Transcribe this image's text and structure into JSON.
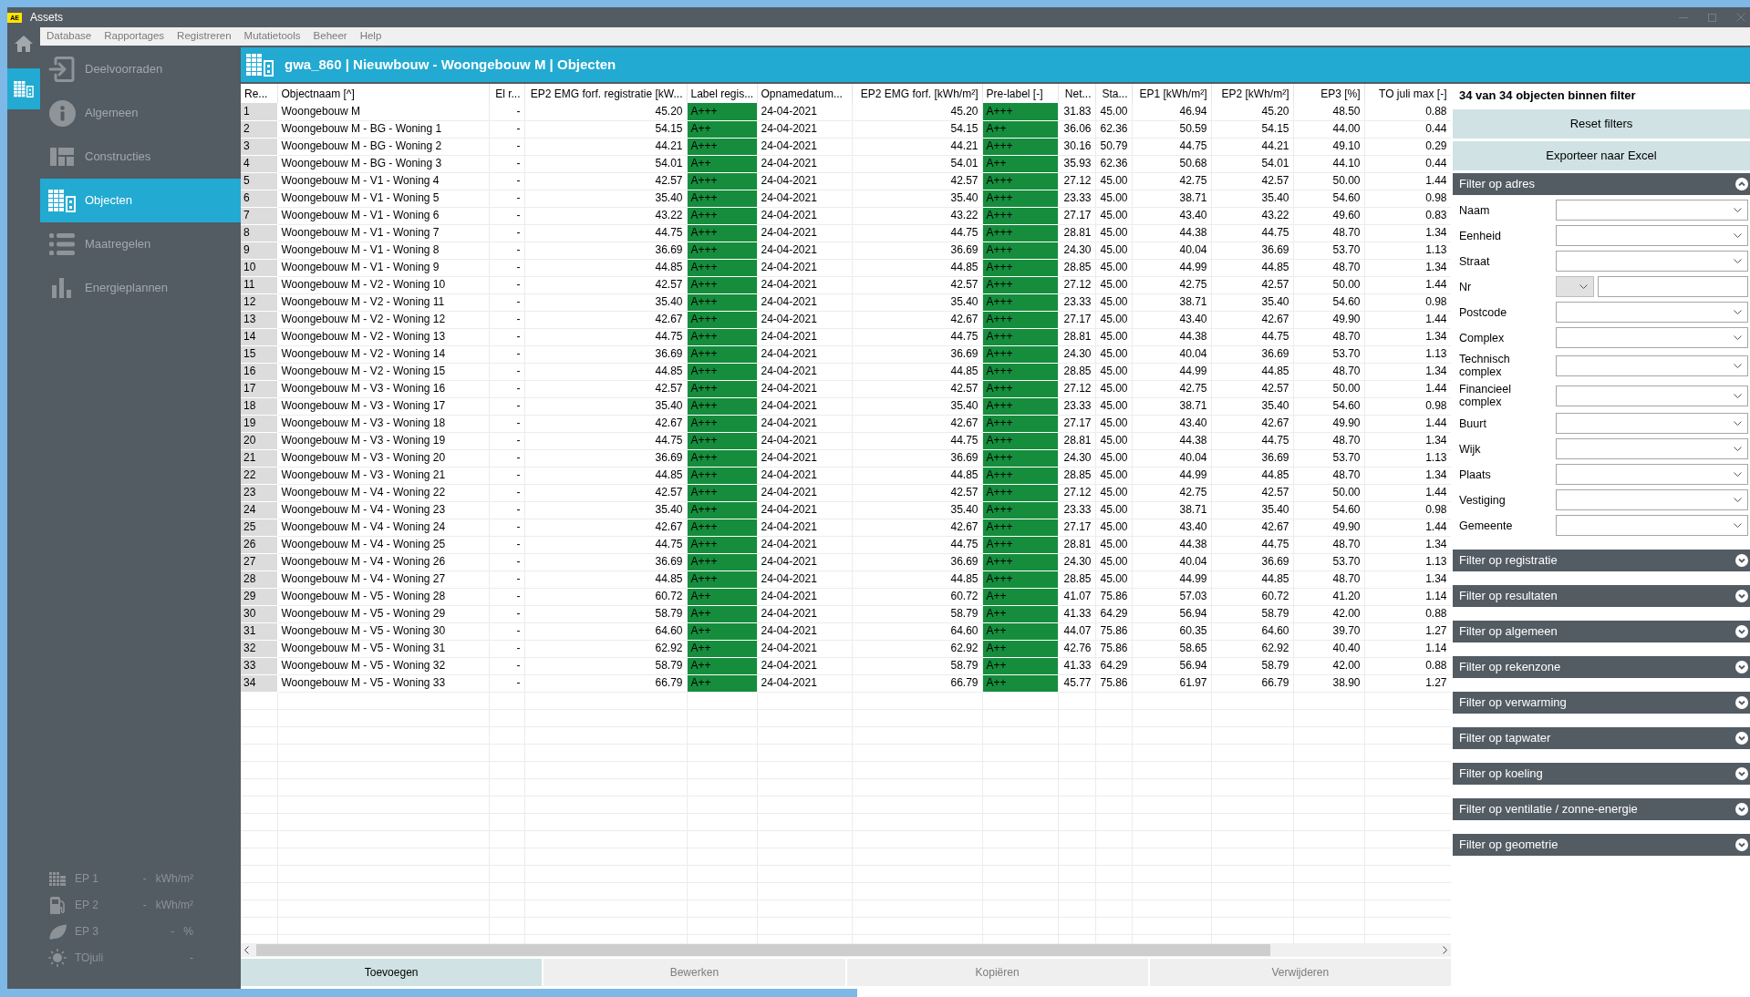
{
  "window": {
    "title": "Assets",
    "logo": "AE"
  },
  "menu": [
    "Database",
    "Rapportages",
    "Registreren",
    "Mutatietools",
    "Beheer",
    "Help"
  ],
  "rail": [
    {
      "selected": false
    },
    {
      "selected": true
    }
  ],
  "sidebar": {
    "items": [
      {
        "label": "Deelvoorraden",
        "selected": false
      },
      {
        "label": "Algemeen",
        "selected": false
      },
      {
        "label": "Constructies",
        "selected": false
      },
      {
        "label": "Objecten",
        "selected": true
      },
      {
        "label": "Maatregelen",
        "selected": false
      },
      {
        "label": "Energieplannen",
        "selected": false
      }
    ],
    "stats": [
      {
        "label": "EP 1",
        "value": "-",
        "unit": "kWh/m²"
      },
      {
        "label": "EP 2",
        "value": "-",
        "unit": "kWh/m²"
      },
      {
        "label": "EP 3",
        "value": "-",
        "unit": "%"
      },
      {
        "label": "TOjuli",
        "value": "-"
      }
    ]
  },
  "header": {
    "title": "gwa_860 | Nieuwbouw - Woongebouw M | Objecten"
  },
  "table": {
    "columns": [
      {
        "label": "Re...",
        "kind": "rownum"
      },
      {
        "label": "Objectnaam [^]",
        "kind": "text"
      },
      {
        "label": "El r...",
        "kind": "number"
      },
      {
        "label": "EP2 EMG forf. registratie [kW...",
        "kind": "number"
      },
      {
        "label": "Label regis...",
        "kind": "label"
      },
      {
        "label": "Opnamedatum...",
        "kind": "text"
      },
      {
        "label": "EP2 EMG forf. [kWh/m²]",
        "kind": "number"
      },
      {
        "label": "Pre-label [-]",
        "kind": "label"
      },
      {
        "label": "Net...",
        "kind": "number"
      },
      {
        "label": "Sta...",
        "kind": "number"
      },
      {
        "label": "EP1 [kWh/m²]",
        "kind": "number"
      },
      {
        "label": "EP2 [kWh/m²]",
        "kind": "number"
      },
      {
        "label": "EP3 [%]",
        "kind": "number"
      },
      {
        "label": "TO juli max [-]",
        "kind": "number"
      }
    ],
    "rows": [
      [
        "1",
        "Woongebouw M",
        "-",
        "45.20",
        "A+++",
        "24-04-2021",
        "45.20",
        "A+++",
        "31.83",
        "45.00",
        "46.94",
        "45.20",
        "48.50",
        "0.88"
      ],
      [
        "2",
        "Woongebouw M - BG - Woning 1",
        "-",
        "54.15",
        "A++",
        "24-04-2021",
        "54.15",
        "A++",
        "36.06",
        "62.36",
        "50.59",
        "54.15",
        "44.00",
        "0.44"
      ],
      [
        "3",
        "Woongebouw M - BG - Woning 2",
        "-",
        "44.21",
        "A+++",
        "24-04-2021",
        "44.21",
        "A+++",
        "30.16",
        "50.79",
        "44.75",
        "44.21",
        "49.10",
        "0.29"
      ],
      [
        "4",
        "Woongebouw M - BG - Woning 3",
        "-",
        "54.01",
        "A++",
        "24-04-2021",
        "54.01",
        "A++",
        "35.93",
        "62.36",
        "50.68",
        "54.01",
        "44.10",
        "0.44"
      ],
      [
        "5",
        "Woongebouw M - V1 - Woning 4",
        "-",
        "42.57",
        "A+++",
        "24-04-2021",
        "42.57",
        "A+++",
        "27.12",
        "45.00",
        "42.75",
        "42.57",
        "50.00",
        "1.44"
      ],
      [
        "6",
        "Woongebouw M - V1 - Woning 5",
        "-",
        "35.40",
        "A+++",
        "24-04-2021",
        "35.40",
        "A+++",
        "23.33",
        "45.00",
        "38.71",
        "35.40",
        "54.60",
        "0.98"
      ],
      [
        "7",
        "Woongebouw M - V1 - Woning 6",
        "-",
        "43.22",
        "A+++",
        "24-04-2021",
        "43.22",
        "A+++",
        "27.17",
        "45.00",
        "43.40",
        "43.22",
        "49.60",
        "0.83"
      ],
      [
        "8",
        "Woongebouw M - V1 - Woning 7",
        "-",
        "44.75",
        "A+++",
        "24-04-2021",
        "44.75",
        "A+++",
        "28.81",
        "45.00",
        "44.38",
        "44.75",
        "48.70",
        "1.34"
      ],
      [
        "9",
        "Woongebouw M - V1 - Woning 8",
        "-",
        "36.69",
        "A+++",
        "24-04-2021",
        "36.69",
        "A+++",
        "24.30",
        "45.00",
        "40.04",
        "36.69",
        "53.70",
        "1.13"
      ],
      [
        "10",
        "Woongebouw M - V1 - Woning 9",
        "-",
        "44.85",
        "A+++",
        "24-04-2021",
        "44.85",
        "A+++",
        "28.85",
        "45.00",
        "44.99",
        "44.85",
        "48.70",
        "1.34"
      ],
      [
        "11",
        "Woongebouw M - V2 - Woning 10",
        "-",
        "42.57",
        "A+++",
        "24-04-2021",
        "42.57",
        "A+++",
        "27.12",
        "45.00",
        "42.75",
        "42.57",
        "50.00",
        "1.44"
      ],
      [
        "12",
        "Woongebouw M - V2 - Woning 11",
        "-",
        "35.40",
        "A+++",
        "24-04-2021",
        "35.40",
        "A+++",
        "23.33",
        "45.00",
        "38.71",
        "35.40",
        "54.60",
        "0.98"
      ],
      [
        "13",
        "Woongebouw M - V2 - Woning 12",
        "-",
        "42.67",
        "A+++",
        "24-04-2021",
        "42.67",
        "A+++",
        "27.17",
        "45.00",
        "43.40",
        "42.67",
        "49.90",
        "1.44"
      ],
      [
        "14",
        "Woongebouw M - V2 - Woning 13",
        "-",
        "44.75",
        "A+++",
        "24-04-2021",
        "44.75",
        "A+++",
        "28.81",
        "45.00",
        "44.38",
        "44.75",
        "48.70",
        "1.34"
      ],
      [
        "15",
        "Woongebouw M - V2 - Woning 14",
        "-",
        "36.69",
        "A+++",
        "24-04-2021",
        "36.69",
        "A+++",
        "24.30",
        "45.00",
        "40.04",
        "36.69",
        "53.70",
        "1.13"
      ],
      [
        "16",
        "Woongebouw M - V2 - Woning 15",
        "-",
        "44.85",
        "A+++",
        "24-04-2021",
        "44.85",
        "A+++",
        "28.85",
        "45.00",
        "44.99",
        "44.85",
        "48.70",
        "1.34"
      ],
      [
        "17",
        "Woongebouw M - V3 - Woning 16",
        "-",
        "42.57",
        "A+++",
        "24-04-2021",
        "42.57",
        "A+++",
        "27.12",
        "45.00",
        "42.75",
        "42.57",
        "50.00",
        "1.44"
      ],
      [
        "18",
        "Woongebouw M - V3 - Woning 17",
        "-",
        "35.40",
        "A+++",
        "24-04-2021",
        "35.40",
        "A+++",
        "23.33",
        "45.00",
        "38.71",
        "35.40",
        "54.60",
        "0.98"
      ],
      [
        "19",
        "Woongebouw M - V3 - Woning 18",
        "-",
        "42.67",
        "A+++",
        "24-04-2021",
        "42.67",
        "A+++",
        "27.17",
        "45.00",
        "43.40",
        "42.67",
        "49.90",
        "1.44"
      ],
      [
        "20",
        "Woongebouw M - V3 - Woning 19",
        "-",
        "44.75",
        "A+++",
        "24-04-2021",
        "44.75",
        "A+++",
        "28.81",
        "45.00",
        "44.38",
        "44.75",
        "48.70",
        "1.34"
      ],
      [
        "21",
        "Woongebouw M - V3 - Woning 20",
        "-",
        "36.69",
        "A+++",
        "24-04-2021",
        "36.69",
        "A+++",
        "24.30",
        "45.00",
        "40.04",
        "36.69",
        "53.70",
        "1.13"
      ],
      [
        "22",
        "Woongebouw M - V3 - Woning 21",
        "-",
        "44.85",
        "A+++",
        "24-04-2021",
        "44.85",
        "A+++",
        "28.85",
        "45.00",
        "44.99",
        "44.85",
        "48.70",
        "1.34"
      ],
      [
        "23",
        "Woongebouw M - V4 - Woning 22",
        "-",
        "42.57",
        "A+++",
        "24-04-2021",
        "42.57",
        "A+++",
        "27.12",
        "45.00",
        "42.75",
        "42.57",
        "50.00",
        "1.44"
      ],
      [
        "24",
        "Woongebouw M - V4 - Woning 23",
        "-",
        "35.40",
        "A+++",
        "24-04-2021",
        "35.40",
        "A+++",
        "23.33",
        "45.00",
        "38.71",
        "35.40",
        "54.60",
        "0.98"
      ],
      [
        "25",
        "Woongebouw M - V4 - Woning 24",
        "-",
        "42.67",
        "A+++",
        "24-04-2021",
        "42.67",
        "A+++",
        "27.17",
        "45.00",
        "43.40",
        "42.67",
        "49.90",
        "1.44"
      ],
      [
        "26",
        "Woongebouw M - V4 - Woning 25",
        "-",
        "44.75",
        "A+++",
        "24-04-2021",
        "44.75",
        "A+++",
        "28.81",
        "45.00",
        "44.38",
        "44.75",
        "48.70",
        "1.34"
      ],
      [
        "27",
        "Woongebouw M - V4 - Woning 26",
        "-",
        "36.69",
        "A+++",
        "24-04-2021",
        "36.69",
        "A+++",
        "24.30",
        "45.00",
        "40.04",
        "36.69",
        "53.70",
        "1.13"
      ],
      [
        "28",
        "Woongebouw M - V4 - Woning 27",
        "-",
        "44.85",
        "A+++",
        "24-04-2021",
        "44.85",
        "A+++",
        "28.85",
        "45.00",
        "44.99",
        "44.85",
        "48.70",
        "1.34"
      ],
      [
        "29",
        "Woongebouw M - V5 - Woning 28",
        "-",
        "60.72",
        "A++",
        "24-04-2021",
        "60.72",
        "A++",
        "41.07",
        "75.86",
        "57.03",
        "60.72",
        "41.20",
        "1.14"
      ],
      [
        "30",
        "Woongebouw M - V5 - Woning 29",
        "-",
        "58.79",
        "A++",
        "24-04-2021",
        "58.79",
        "A++",
        "41.33",
        "64.29",
        "56.94",
        "58.79",
        "42.00",
        "0.88"
      ],
      [
        "31",
        "Woongebouw M - V5 - Woning 30",
        "-",
        "64.60",
        "A++",
        "24-04-2021",
        "64.60",
        "A++",
        "44.07",
        "75.86",
        "60.35",
        "64.60",
        "39.70",
        "1.27"
      ],
      [
        "32",
        "Woongebouw M - V5 - Woning 31",
        "-",
        "62.92",
        "A++",
        "24-04-2021",
        "62.92",
        "A++",
        "42.76",
        "75.86",
        "58.65",
        "62.92",
        "40.40",
        "1.14"
      ],
      [
        "33",
        "Woongebouw M - V5 - Woning 32",
        "-",
        "58.79",
        "A++",
        "24-04-2021",
        "58.79",
        "A++",
        "41.33",
        "64.29",
        "56.94",
        "58.79",
        "42.00",
        "0.88"
      ],
      [
        "34",
        "Woongebouw M - V5 - Woning 33",
        "-",
        "66.79",
        "A++",
        "24-04-2021",
        "66.79",
        "A++",
        "45.77",
        "75.86",
        "61.97",
        "66.79",
        "38.90",
        "1.27"
      ]
    ]
  },
  "filter_panel": {
    "count": "34 van 34 objecten binnen filter",
    "buttons": [
      "Reset filters",
      "Exporteer naar Excel"
    ],
    "sections": [
      {
        "title": "Filter op adres",
        "expanded": true,
        "fields": [
          {
            "label": "Naam",
            "kind": "select"
          },
          {
            "label": "Eenheid",
            "kind": "select"
          },
          {
            "label": "Straat",
            "kind": "select"
          },
          {
            "label": "Nr",
            "kind": "select-text"
          },
          {
            "label": "Postcode",
            "kind": "select"
          },
          {
            "label": "Complex",
            "kind": "select"
          },
          {
            "label": "Technisch complex",
            "kind": "select"
          },
          {
            "label": "Financieel complex",
            "kind": "select"
          },
          {
            "label": "Buurt",
            "kind": "select"
          },
          {
            "label": "Wijk",
            "kind": "select"
          },
          {
            "label": "Plaats",
            "kind": "select"
          },
          {
            "label": "Vestiging",
            "kind": "select"
          },
          {
            "label": "Gemeente",
            "kind": "select"
          }
        ]
      },
      {
        "title": "Filter op registratie",
        "expanded": false
      },
      {
        "title": "Filter op resultaten",
        "expanded": false
      },
      {
        "title": "Filter op algemeen",
        "expanded": false
      },
      {
        "title": "Filter op rekenzone",
        "expanded": false
      },
      {
        "title": "Filter op verwarming",
        "expanded": false
      },
      {
        "title": "Filter op tapwater",
        "expanded": false
      },
      {
        "title": "Filter op koeling",
        "expanded": false
      },
      {
        "title": "Filter op ventilatie / zonne-energie",
        "expanded": false
      },
      {
        "title": "Filter op geometrie",
        "expanded": false
      }
    ]
  },
  "actions": [
    {
      "label": "Toevoegen",
      "disabled": false
    },
    {
      "label": "Bewerken",
      "disabled": true
    },
    {
      "label": "Kopiëren",
      "disabled": true
    },
    {
      "label": "Verwijderen",
      "disabled": true
    }
  ]
}
